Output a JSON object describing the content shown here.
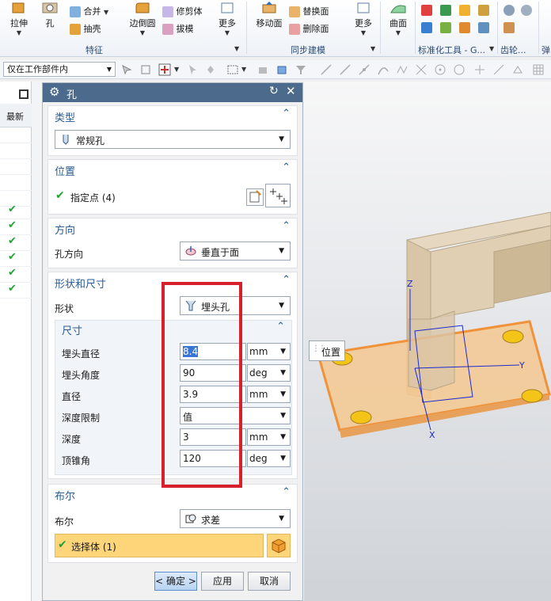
{
  "ribbon": {
    "extrude": "拉伸",
    "hole": "孔",
    "unite": "合并",
    "shell": "抽壳",
    "edge_blend": "边倒圆",
    "trim_body": "修剪体",
    "draft": "拔模",
    "more1": "更多",
    "group_feature": "特征",
    "move_face": "移动面",
    "replace_face": "替换面",
    "delete_face": "删除面",
    "more2": "更多",
    "group_sync": "同步建模",
    "surface": "曲面",
    "group_std": "标准化工具 - G...",
    "group_gear": "齿轮...",
    "group_spring": "弹"
  },
  "filterbar": {
    "scope": "仅在工作部件内"
  },
  "nav": {
    "header": "最新"
  },
  "dialog": {
    "title": "孔",
    "type": {
      "title": "类型",
      "value": "常规孔"
    },
    "position": {
      "title": "位置",
      "point_label": "指定点 (4)"
    },
    "direction": {
      "title": "方向",
      "label": "孔方向",
      "value": "垂直于面"
    },
    "shape": {
      "title": "形状和尺寸",
      "label": "形状",
      "value": "埋头孔",
      "dims_title": "尺寸",
      "params": [
        {
          "label": "埋头直径",
          "value": "8.4",
          "unit": "mm"
        },
        {
          "label": "埋头角度",
          "value": "90",
          "unit": "deg"
        },
        {
          "label": "直径",
          "value": "3.9",
          "unit": "mm"
        },
        {
          "label": "深度限制",
          "value": "值",
          "unit": ""
        },
        {
          "label": "深度",
          "value": "3",
          "unit": "mm"
        },
        {
          "label": "顶锥角",
          "value": "120",
          "unit": "deg"
        }
      ]
    },
    "boolean": {
      "title": "布尔",
      "label": "布尔",
      "value": "求差",
      "select_body": "选择体 (1)"
    },
    "buttons": {
      "ok": "< 确定 >",
      "apply": "应用",
      "cancel": "取消"
    }
  },
  "viewport": {
    "tooltip": "位置",
    "axis_z": "Z",
    "axis_y": "Y",
    "axis_x": "X"
  },
  "colors": {
    "title_bar": "#4b6a8c",
    "section_title": "#2b5c92",
    "highlight_row": "#ffd57a",
    "annotation_red": "#d7202b",
    "plate_fill": "#f5c890",
    "plate_edge": "#f0923a",
    "block_fill": "#d9c6a8"
  }
}
